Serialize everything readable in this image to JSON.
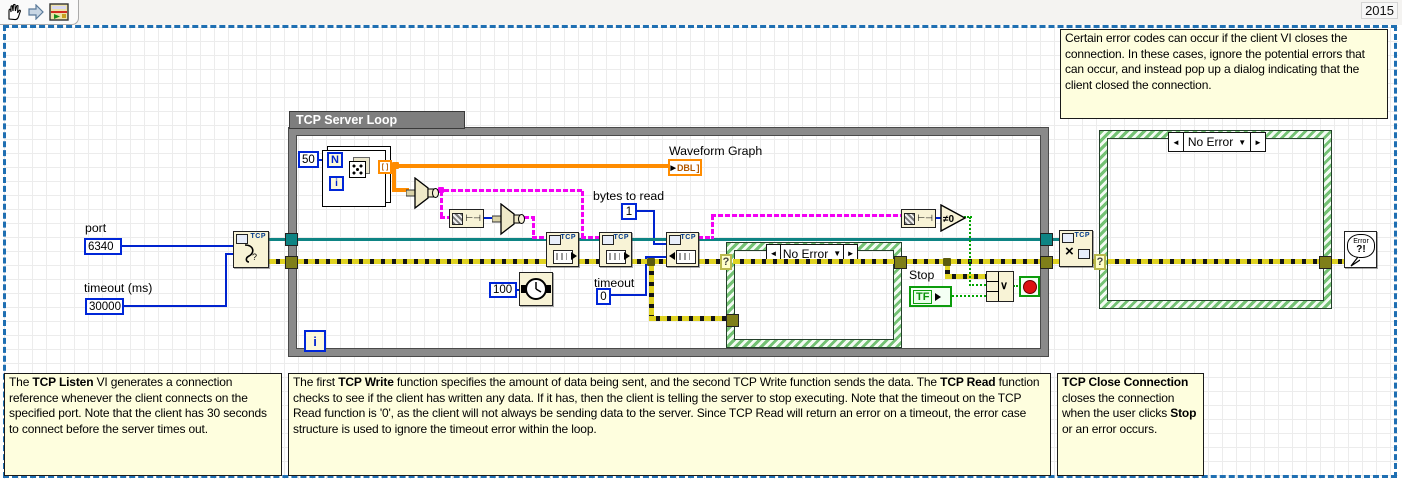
{
  "window": {
    "year": "2015"
  },
  "terminals": {
    "port": {
      "label": "port",
      "value": "6340"
    },
    "timeout_ms": {
      "label": "timeout (ms)",
      "value": "30000"
    },
    "bytes_to_read": {
      "label": "bytes to read",
      "value": "1"
    },
    "read_timeout": {
      "label": "timeout",
      "value": "0"
    },
    "wait_ms": {
      "value": "100"
    },
    "loop_count": {
      "value": "50"
    },
    "waveform_graph": {
      "label": "Waveform Graph",
      "type": "DBL"
    },
    "stop": {
      "label": "Stop",
      "boolean": "TF"
    }
  },
  "loop": {
    "title": "TCP Server Loop",
    "n": "N",
    "i_for": "i",
    "i_while": "i"
  },
  "cases": {
    "inner": {
      "selector": "No Error",
      "dec": "◄",
      "inc": "►",
      "down": "▼",
      "question": "?"
    },
    "outer": {
      "selector": "No Error",
      "dec": "◄",
      "inc": "►",
      "down": "▼",
      "question": "?"
    }
  },
  "nodes": {
    "tcp_label": "TCP",
    "close_x": "×",
    "listen_q": "?",
    "neq_zero": "≠0",
    "or_symbol": "∨",
    "error_handler_line1": "Error",
    "error_handler_line2": "?!"
  },
  "notes": {
    "client_close": "Certain error codes can occur if the client VI closes the connection. In these cases, ignore the potential errors that can occur, and instead pop up a dialog indicating that the client closed the connection.",
    "tcp_listen": {
      "p1": "The ",
      "b1": "TCP Listen",
      "p2": " VI generates a connection reference whenever the client connects on the specified port. Note that the client has 30 seconds to connect before the server times out."
    },
    "tcp_write": {
      "p1": "The first ",
      "b1": "TCP Write",
      "p2": " function specifies the amount of data being sent, and the second TCP Write function sends the data.  The ",
      "b2": "TCP Read",
      "p3": " function checks to see if the client has written any data. If it has, then the client is telling the server to stop executing. Note that the timeout on the TCP Read function is '0', as the client will not always be sending data to the server. Since TCP Read will return an error on a timeout, the error case structure is used to ignore the timeout error within the loop."
    },
    "tcp_close": {
      "b1": "TCP Close Connection",
      "p1": " closes the connection when the user clicks ",
      "b2": "Stop",
      "p2": " or an error occurs."
    }
  }
}
